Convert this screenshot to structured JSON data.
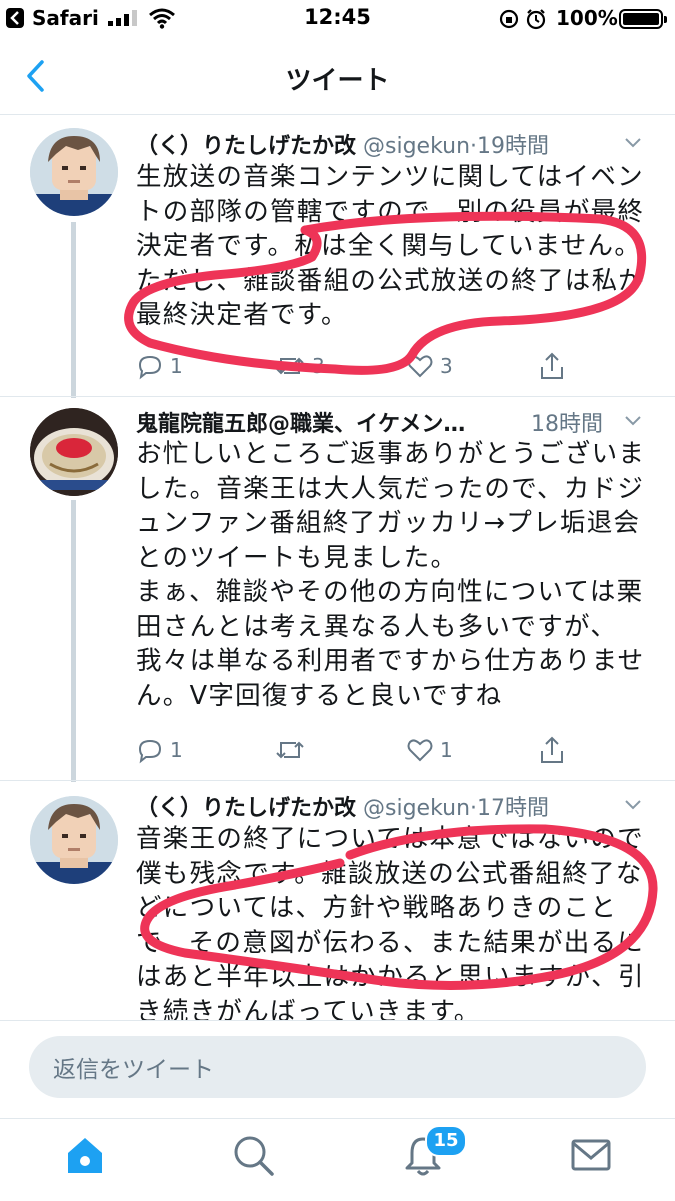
{
  "status_bar": {
    "back_app": "Safari",
    "time": "12:45",
    "battery": "100%"
  },
  "nav": {
    "title": "ツイート"
  },
  "tweets": [
    {
      "name": "（く）りたしげたか改",
      "handle": "@sigekun",
      "time": "·19時間",
      "text": "生放送の音楽コンテンツに関してはイベントの部隊の管轄ですので、別の役員が最終決定者です。私は全く関与していません。ただし、雑談番組の公式放送の終了は私が最終決定者です。",
      "reply_count": "1",
      "retweet_count": "3",
      "like_count": "3"
    },
    {
      "name": "鬼龍院龍五郎@職業、イケメン…",
      "handle": "",
      "time": "18時間",
      "text": "お忙しいところご返事ありがとうございました。音楽王は大人気だったので、カドジュンファン番組終了ガッカリ→プレ垢退会とのツイートも見ました。\nまぁ、雑談やその他の方向性については栗田さんとは考え異なる人も多いですが、我々は単なる利用者ですから仕方ありません。V字回復すると良いですね",
      "reply_count": "1",
      "retweet_count": "",
      "like_count": "1"
    },
    {
      "name": "（く）りたしげたか改",
      "handle": "@sigekun",
      "time": "·17時間",
      "text": "音楽王の終了については本意ではないので僕も残念です。雑談放送の公式番組終了などについては、方針や戦略ありきのことで、その意図が伝わる、また結果が出るにはあと半年以上はかかると思いますが、引き続きがんばっていきます。",
      "reply_count": "",
      "retweet_count": "",
      "like_count": ""
    }
  ],
  "reply": {
    "placeholder": "返信をツイート"
  },
  "tabbar": {
    "notifications_badge": "15"
  },
  "colors": {
    "accent": "#1da1f2",
    "marker": "#ee3457",
    "secondary_text": "#657786"
  }
}
